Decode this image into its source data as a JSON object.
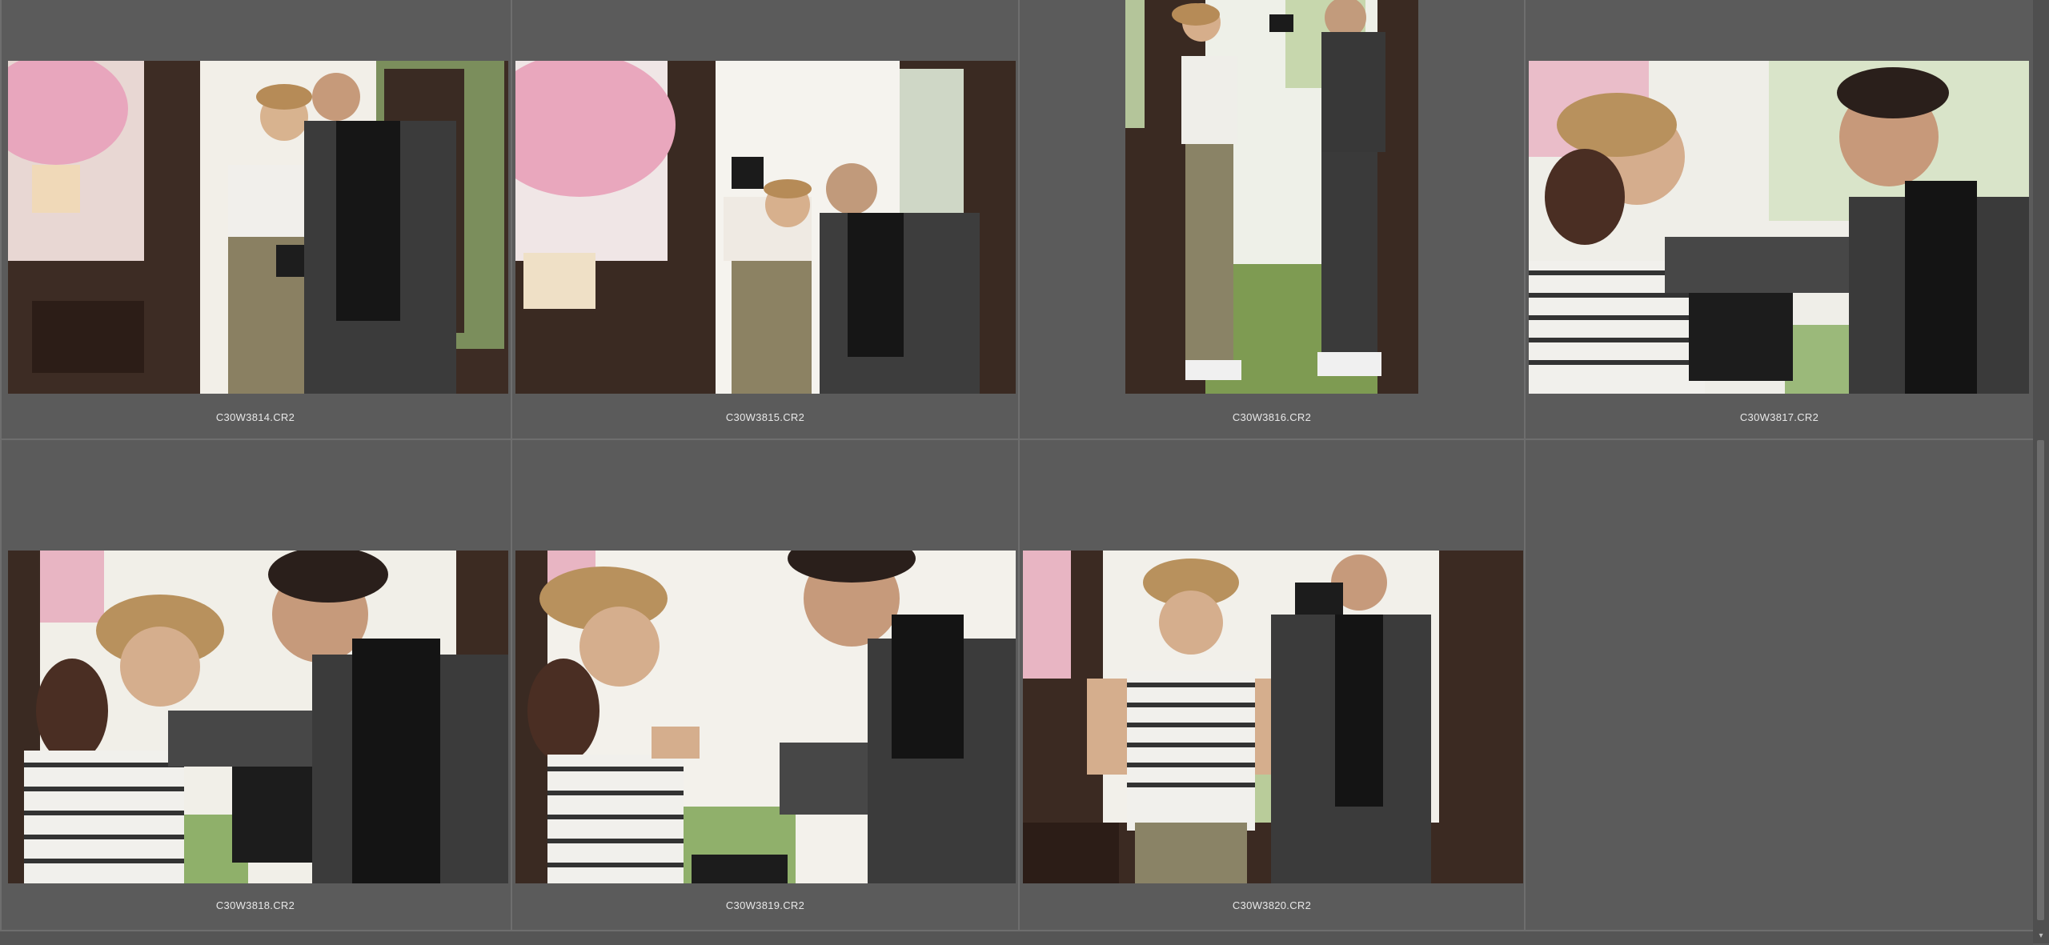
{
  "browser": {
    "thumbnails": [
      {
        "filename": "C30W3814.CR2"
      },
      {
        "filename": "C30W3815.CR2"
      },
      {
        "filename": "C30W3816.CR2"
      },
      {
        "filename": "C30W3817.CR2"
      },
      {
        "filename": "C30W3818.CR2"
      },
      {
        "filename": "C30W3819.CR2"
      },
      {
        "filename": "C30W3820.CR2"
      }
    ]
  },
  "colors": {
    "background": "#5b5b5b",
    "grid_line": "#6e6e6e",
    "caption_text": "#e8e8e8"
  },
  "icons": {
    "scroll_down": "▾"
  }
}
